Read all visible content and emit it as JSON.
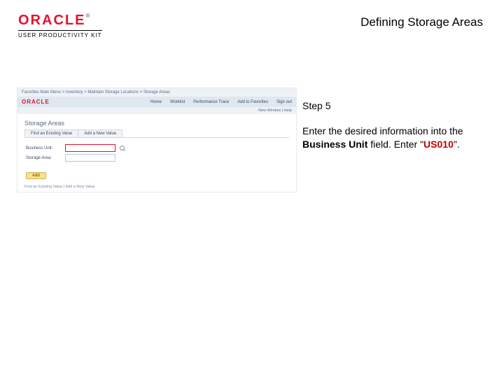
{
  "brand": {
    "name": "ORACLE",
    "tm": "®",
    "sub": "USER PRODUCTIVITY KIT"
  },
  "title": "Defining Storage Areas",
  "step": "Step 5",
  "instruction": {
    "p1": "Enter the desired information into the ",
    "bold1": "Business Unit",
    "p2": " field. Enter \"",
    "val": "US010",
    "p3": "\"."
  },
  "shot": {
    "crumb": "Favorites   Main Menu > Inventory > Maintain Storage Locations > Storage Areas",
    "logo": "ORACLE",
    "menu": [
      "Home",
      "Worklist",
      "Performance Trace",
      "Add to Favorites",
      "Sign out"
    ],
    "userline": "New Window | Help",
    "heading": "Storage Areas",
    "tabs": [
      "Find an Existing Value",
      "Add a New Value"
    ],
    "rows": [
      {
        "label": "Business Unit:"
      },
      {
        "label": "Storage Area:"
      }
    ],
    "btn": "Add",
    "footer": "Find an Existing Value | Add a New Value"
  }
}
